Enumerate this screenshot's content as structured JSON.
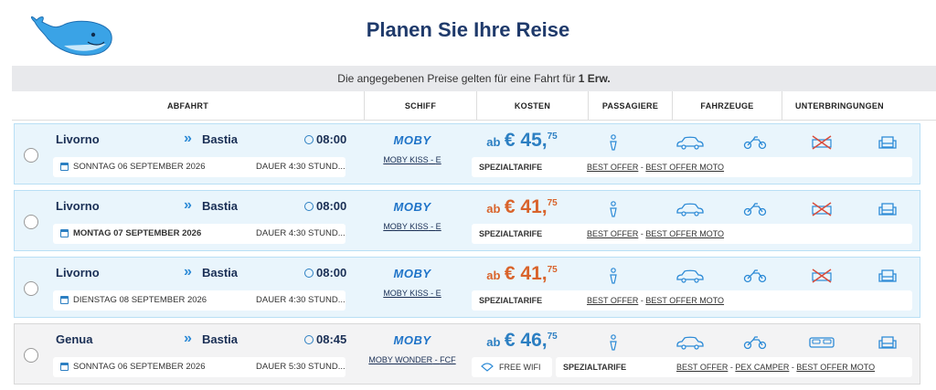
{
  "header": {
    "title": "Planen Sie Ihre Reise",
    "notice_prefix": "Die angegebenen Preise gelten für eine Fahrt für",
    "notice_bold": "1 Erw."
  },
  "columns": {
    "abfahrt": "ABFAHRT",
    "schiff": "SCHIFF",
    "kosten": "KOSTEN",
    "passagiere": "PASSAGIERE",
    "fahrzeuge": "FAHRZEUGE",
    "unterbringungen": "UNTERBRINGUNGEN"
  },
  "colors": {
    "accent_blue": "#2c7fc2",
    "price_orange": "#d9632b",
    "title_navy": "#1f3a6b"
  },
  "rows": [
    {
      "from": "Livorno",
      "to": "Bastia",
      "time": "08:00",
      "date": "SONNTAG 06 SEPTEMBER 2026",
      "duration": "DAUER 4:30 STUND...",
      "operator": "MOBY",
      "ship": "MOBY KISS",
      "ship_suffix": "E",
      "price_prefix": "ab",
      "price_main": "€ 45,",
      "price_cents": "75",
      "tariff_label": "SPEZIALTARIFE",
      "offer1": "BEST OFFER",
      "sep": "-",
      "offer2": "BEST OFFER MOTO"
    },
    {
      "from": "Livorno",
      "to": "Bastia",
      "time": "08:00",
      "date": "MONTAG 07 SEPTEMBER 2026",
      "duration": "DAUER 4:30 STUND...",
      "operator": "MOBY",
      "ship": "MOBY KISS",
      "ship_suffix": "E",
      "price_prefix": "ab",
      "price_main": "€ 41,",
      "price_cents": "75",
      "tariff_label": "SPEZIALTARIFE",
      "offer1": "BEST OFFER",
      "sep": "-",
      "offer2": "BEST OFFER MOTO"
    },
    {
      "from": "Livorno",
      "to": "Bastia",
      "time": "08:00",
      "date": "DIENSTAG 08 SEPTEMBER 2026",
      "duration": "DAUER 4:30 STUND...",
      "operator": "MOBY",
      "ship": "MOBY KISS",
      "ship_suffix": "E",
      "price_prefix": "ab",
      "price_main": "€ 41,",
      "price_cents": "75",
      "tariff_label": "SPEZIALTARIFE",
      "offer1": "BEST OFFER",
      "sep": "-",
      "offer2": "BEST OFFER MOTO"
    },
    {
      "from": "Genua",
      "to": "Bastia",
      "time": "08:45",
      "date": "SONNTAG 06 SEPTEMBER 2026",
      "duration": "DAUER 5:30 STUND...",
      "operator": "MOBY",
      "ship": "MOBY WONDER",
      "ship_suffix": "FCF",
      "price_prefix": "ab",
      "price_main": "€ 46,",
      "price_cents": "75",
      "wifi_label": "FREE WIFI",
      "tariff_label": "SPEZIALTARIFE",
      "offer1": "BEST OFFER",
      "sep": "-",
      "offer2": "PEX CAMPER",
      "sep2": "-",
      "offer3": "BEST OFFER MOTO"
    }
  ]
}
